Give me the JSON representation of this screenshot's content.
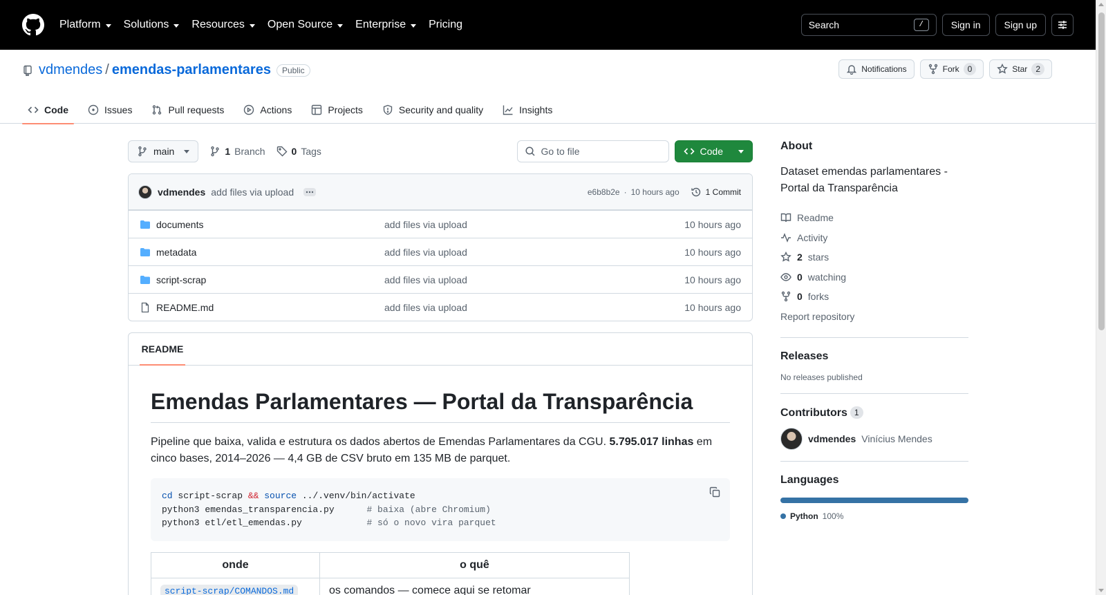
{
  "header": {
    "nav": [
      "Platform",
      "Solutions",
      "Resources",
      "Open Source",
      "Enterprise",
      "Pricing"
    ],
    "search_label": "Search",
    "search_key": "/",
    "sign_in": "Sign in",
    "sign_up": "Sign up"
  },
  "repo": {
    "owner": "vdmendes",
    "separator": "/",
    "name": "emendas-parlamentares",
    "visibility": "Public",
    "notifications_label": "Notifications",
    "fork_label": "Fork",
    "fork_count": "0",
    "star_label": "Star",
    "star_count": "2",
    "tabs": [
      "Code",
      "Issues",
      "Pull requests",
      "Actions",
      "Projects",
      "Security and quality",
      "Insights"
    ]
  },
  "toolbar": {
    "branch": "main",
    "branch_count": "1",
    "branch_word": "Branch",
    "tag_count": "0",
    "tag_word": "Tags",
    "goto_placeholder": "Go to file",
    "code_button": "Code"
  },
  "commit": {
    "user": "vdmendes",
    "message": "add files via upload",
    "sha": "e6b8b2e",
    "separator": "·",
    "time": "10 hours ago",
    "count_label": "1 Commit"
  },
  "files": [
    {
      "name": "documents",
      "type": "dir",
      "message": "add files via upload",
      "time": "10 hours ago"
    },
    {
      "name": "metadata",
      "type": "dir",
      "message": "add files via upload",
      "time": "10 hours ago"
    },
    {
      "name": "script-scrap",
      "type": "dir",
      "message": "add files via upload",
      "time": "10 hours ago"
    },
    {
      "name": "README.md",
      "type": "file",
      "message": "add files via upload",
      "time": "10 hours ago"
    }
  ],
  "readme": {
    "tab": "README",
    "title": "Emendas Parlamentares — Portal da Transparência",
    "intro_a": "Pipeline que baixa, valida e estrutura os dados abertos de Emendas Parlamentares da CGU. ",
    "intro_bold": "5.795.017 linhas",
    "intro_b": " em cinco bases, 2014–2026 — 4,4 GB de CSV bruto em 135 MB de parquet.",
    "code": {
      "l1_kw1": "cd",
      "l1_mid": " script-scrap ",
      "l1_op": "&&",
      "l1_kw2": " source",
      "l1_end": " ../.venv/bin/activate",
      "l2_cmd": "python3 emendas_transparencia.py      ",
      "l2_cm": "# baixa (abre Chromium)",
      "l3_cmd": "python3 etl/etl_emendas.py            ",
      "l3_cm": "# só o novo vira parquet"
    },
    "table_headers": [
      "onde",
      "o quê"
    ],
    "table_row_code": "script-scrap/COMANDOS.md",
    "table_row_text": "os comandos — comece aqui se retomar"
  },
  "sidebar": {
    "about_title": "About",
    "description": "Dataset emendas parlamentares - Portal da Transparência",
    "readme": "Readme",
    "activity": "Activity",
    "stars_count": "2",
    "stars_word": "stars",
    "watching_count": "0",
    "watching_word": "watching",
    "forks_count": "0",
    "forks_word": "forks",
    "report": "Report repository",
    "releases_title": "Releases",
    "releases_empty": "No releases published",
    "contributors_title": "Contributors",
    "contributors_count": "1",
    "contributor_login": "vdmendes",
    "contributor_name": "Vinícius Mendes",
    "languages_title": "Languages",
    "language": "Python",
    "language_pct": "100%",
    "language_color": "#3572A5"
  }
}
